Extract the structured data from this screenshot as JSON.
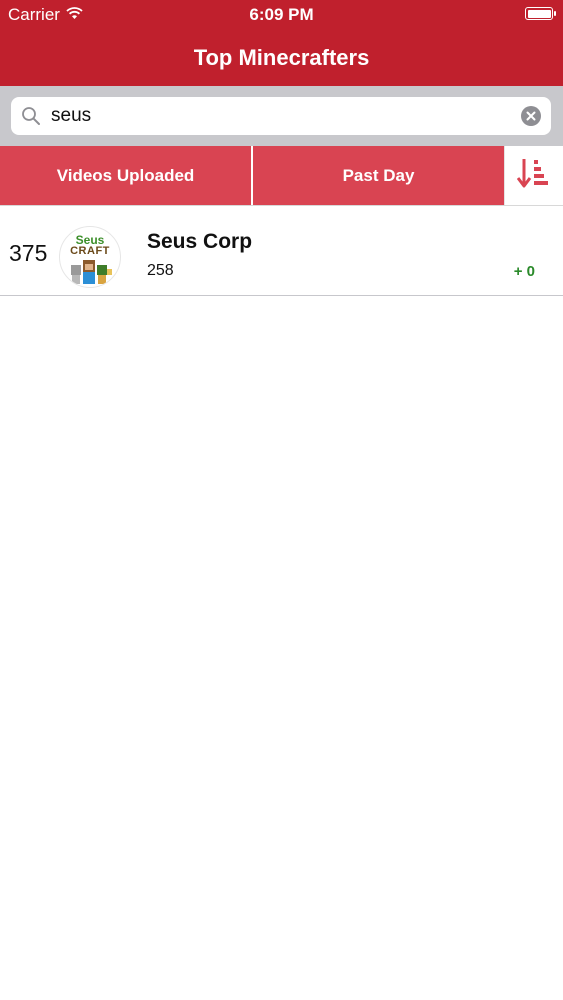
{
  "status_bar": {
    "carrier": "Carrier",
    "time": "6:09 PM"
  },
  "nav": {
    "title": "Top Minecrafters"
  },
  "search": {
    "value": "seus"
  },
  "filters": {
    "metric": "Videos Uploaded",
    "period": "Past Day"
  },
  "results": [
    {
      "rank": "375",
      "name": "Seus Corp",
      "count": "258",
      "delta": "+ 0",
      "avatar_text_top": "Seus",
      "avatar_text_bottom": "CRAFT"
    }
  ],
  "colors": {
    "brand_red": "#c0202d",
    "filter_red": "#d94452",
    "positive_green": "#2a8a2a"
  }
}
